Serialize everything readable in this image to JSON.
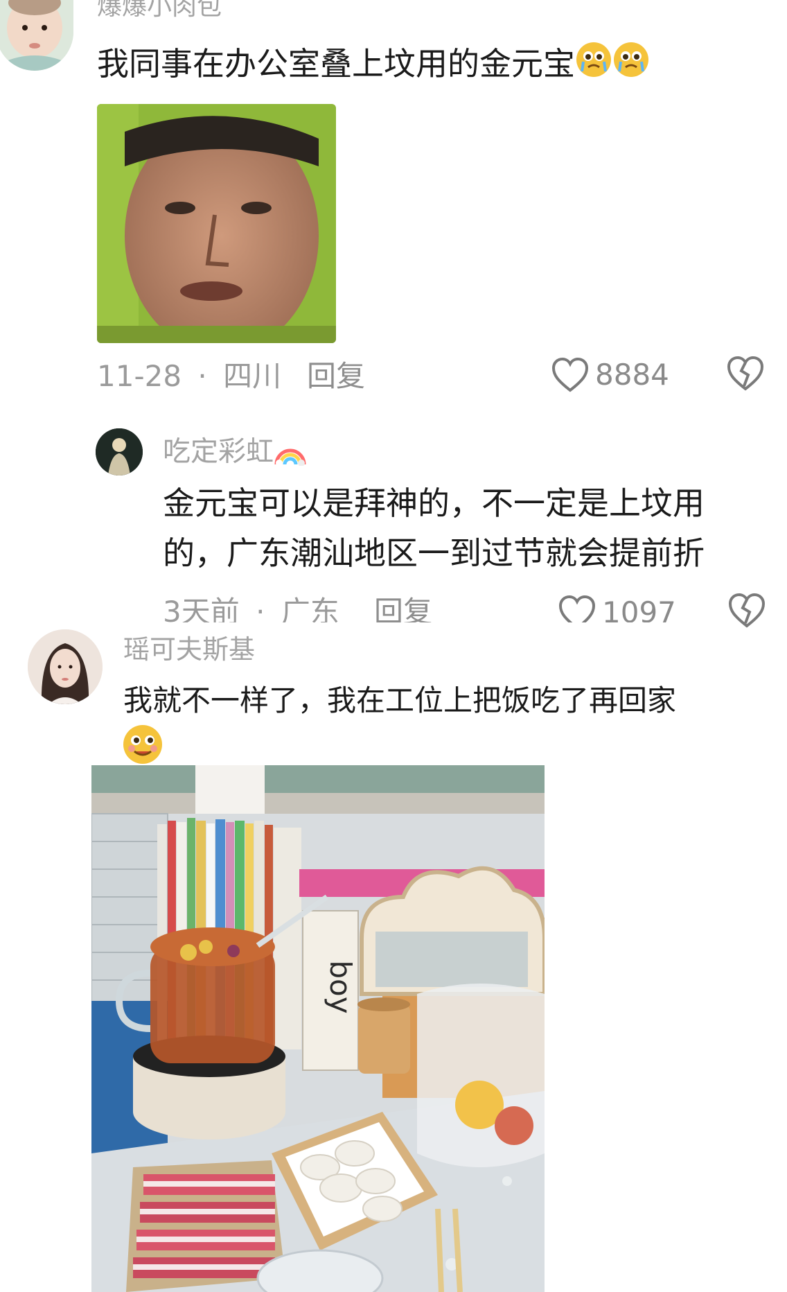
{
  "comments": [
    {
      "username": "爆爆小肉包",
      "text": "我同事在办公室叠上坟用的金元宝",
      "emoji": [
        "crying-face-emoji",
        "crying-face-emoji"
      ],
      "date": "11-28",
      "separator": "·",
      "location": "四川",
      "reply_label": "回复",
      "likes": "8884"
    },
    {
      "username": "吃定彩虹",
      "username_emoji": "rainbow-emoji",
      "text_line1": "金元宝可以是拜神的，不一定是上坟用",
      "text_line2": "的，广东潮汕地区一到过节就会提前折",
      "date": "3天前",
      "separator": "·",
      "location": "广东",
      "reply_label": "回复",
      "likes": "1097"
    },
    {
      "username": "瑶可夫斯基",
      "text": "我就不一样了，我在工位上把饭吃了再回家",
      "emoji": [
        "smiling-face-emoji"
      ],
      "photo_text": "boy"
    }
  ],
  "colors": {
    "name": "#a3a3a3",
    "body": "#1a1a1a",
    "meta": "#9a9a9a",
    "icon": "#7a7a7a"
  }
}
